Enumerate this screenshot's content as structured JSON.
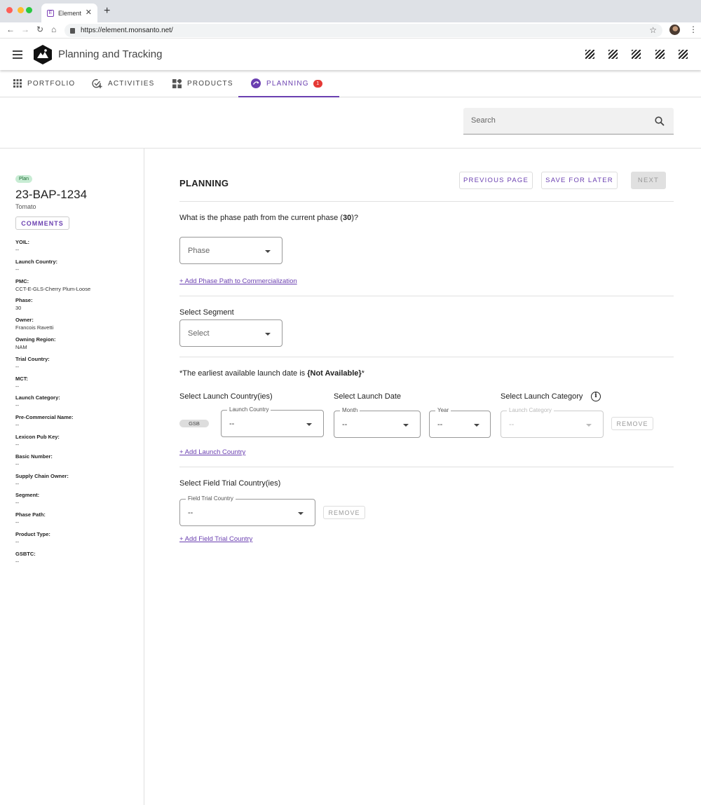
{
  "browser": {
    "tab_title": "Element",
    "tab_favicon_letter": "E",
    "url": "https://element.monsanto.net/"
  },
  "header": {
    "app_title": "Planning and Tracking"
  },
  "nav": {
    "tabs": [
      {
        "label": "PORTFOLIO",
        "icon": "grid-icon"
      },
      {
        "label": "ACTIVITIES",
        "icon": "add-task-icon"
      },
      {
        "label": "PRODUCTS",
        "icon": "widgets-icon"
      },
      {
        "label": "PLANNING",
        "icon": "planning-icon",
        "active": true,
        "badge": "1"
      }
    ]
  },
  "search": {
    "placeholder": "Search"
  },
  "sidebar": {
    "status_chip": "Plan",
    "record_id": "23-BAP-1234",
    "crop": "Tomato",
    "comments_label": "COMMENTS",
    "properties": [
      {
        "label": "YOIL:",
        "value": "--"
      },
      {
        "label": "Launch Country:",
        "value": "--"
      },
      {
        "label": "PMC:",
        "value": "CCT-E-GLS-Cherry Plum-Loose"
      },
      {
        "label": "Phase:",
        "value": "30"
      },
      {
        "label": "Owner:",
        "value": "Francois Ravetti"
      },
      {
        "label": "Owning Region:",
        "value": "NAM"
      },
      {
        "label": "Trial Country:",
        "value": "--"
      },
      {
        "label": "MCT:",
        "value": "--"
      },
      {
        "label": "Launch Category:",
        "value": "--"
      },
      {
        "label": "Pre-Commercial Name:",
        "value": "--"
      },
      {
        "label": "Lexicon Pub Key:",
        "value": "--"
      },
      {
        "label": "Basic Number:",
        "value": "--"
      },
      {
        "label": "Supply Chain Owner:",
        "value": "--"
      },
      {
        "label": "Segment:",
        "value": "--"
      },
      {
        "label": "Phase Path:",
        "value": "--"
      },
      {
        "label": "Product Type:",
        "value": "--"
      },
      {
        "label": "GSBTC:",
        "value": "--"
      }
    ]
  },
  "main": {
    "heading": "PLANNING",
    "buttons": {
      "previous": "PREVIOUS PAGE",
      "save": "SAVE FOR LATER",
      "next": "NEXT"
    },
    "phase_question_prefix": "What is the phase path from the current phase (",
    "phase_question_value": "30",
    "phase_question_suffix": ")?",
    "phase_select": "Phase",
    "add_phase_path_link": "+ Add Phase Path to Commercialization",
    "segment_label": "Select Segment",
    "segment_select": "Select",
    "launch_note_prefix": "*The earliest available launch date is ",
    "launch_note_value": "{Not Available}",
    "launch_note_suffix": "*",
    "launch_country_label": "Select Launch Country(ies)",
    "launch_date_label": "Select Launch Date",
    "launch_category_label": "Select Launch Category",
    "gsb_chip": "GSB",
    "launch_country_float": "Launch Country",
    "launch_country_value": "--",
    "month_float": "Month",
    "month_value": "--",
    "year_float": "Year",
    "year_value": "--",
    "launch_category_float": "Launch Category",
    "launch_category_value": "--",
    "remove_label": "REMOVE",
    "add_launch_country_link": "+ Add Launch Country",
    "field_trial_label": "Select Field Trial Country(ies)",
    "field_trial_float": "Field Trial Country",
    "field_trial_value": "--",
    "add_field_trial_link": "+ Add Field Trial Country"
  }
}
